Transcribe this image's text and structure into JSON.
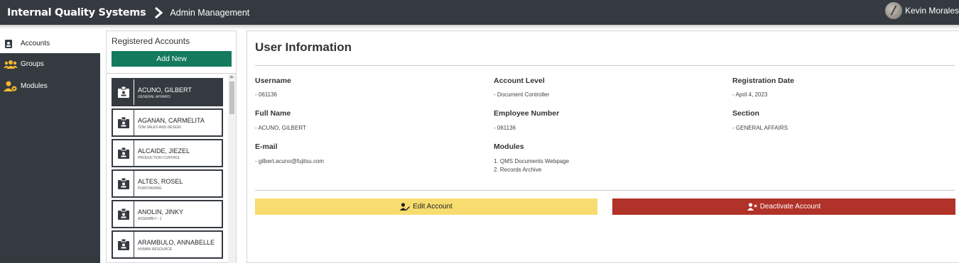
{
  "header": {
    "brand": "Internal Quality Systems",
    "breadcrumb": "Admin Management",
    "user_name": "Kevin Morales"
  },
  "sidebar": {
    "items": [
      {
        "label": "Accounts",
        "icon": "id-badge-icon",
        "active": true
      },
      {
        "label": "Groups",
        "icon": "users-icon",
        "active": false
      },
      {
        "label": "Modules",
        "icon": "user-gear-icon",
        "active": false
      }
    ]
  },
  "accounts_panel": {
    "title": "Registered Accounts",
    "add_button": "Add New",
    "accounts": [
      {
        "name": "ACUNO, GILBERT",
        "department": "GENERAL AFFAIRS",
        "selected": true
      },
      {
        "name": "AGANAN, CARMELITA",
        "department": "TDM SALES AND DESIGN",
        "selected": false
      },
      {
        "name": "ALCAIDE, JIEZEL",
        "department": "PRODUCTION CONTROL",
        "selected": false
      },
      {
        "name": "ALTES, ROSEL",
        "department": "PURCHASING",
        "selected": false
      },
      {
        "name": "ANOLIN, JINKY",
        "department": "ASSEMBLY - 1",
        "selected": false
      },
      {
        "name": "ARAMBULO, ANNABELLE",
        "department": "HUMAN RESOURCE",
        "selected": false
      }
    ]
  },
  "user_info": {
    "title": "User Information",
    "username_label": "Username",
    "username": "- 061136",
    "account_level_label": "Account Level",
    "account_level": "- Document Controller",
    "registration_date_label": "Registration Date",
    "registration_date": "- April 4, 2023",
    "full_name_label": "Full Name",
    "full_name": "- ACUNO, GILBERT",
    "employee_number_label": "Employee Number",
    "employee_number": "- 061136",
    "section_label": "Section",
    "section": "- GENERAL AFFAIRS",
    "email_label": "E-mail",
    "email": "- gilbert.acuno@fujitsu.com",
    "modules_label": "Modules",
    "modules": [
      "1. QMS Documents Webpage",
      "2. Records Archive"
    ],
    "edit_button": "Edit Account",
    "deactivate_button": "Deactivate Account"
  },
  "colors": {
    "topbar": "#343a40",
    "add_button": "#147a5e",
    "edit_button": "#f7dc6f",
    "deactivate_button": "#b03228",
    "sidebar_icon": "#f5b82e"
  }
}
